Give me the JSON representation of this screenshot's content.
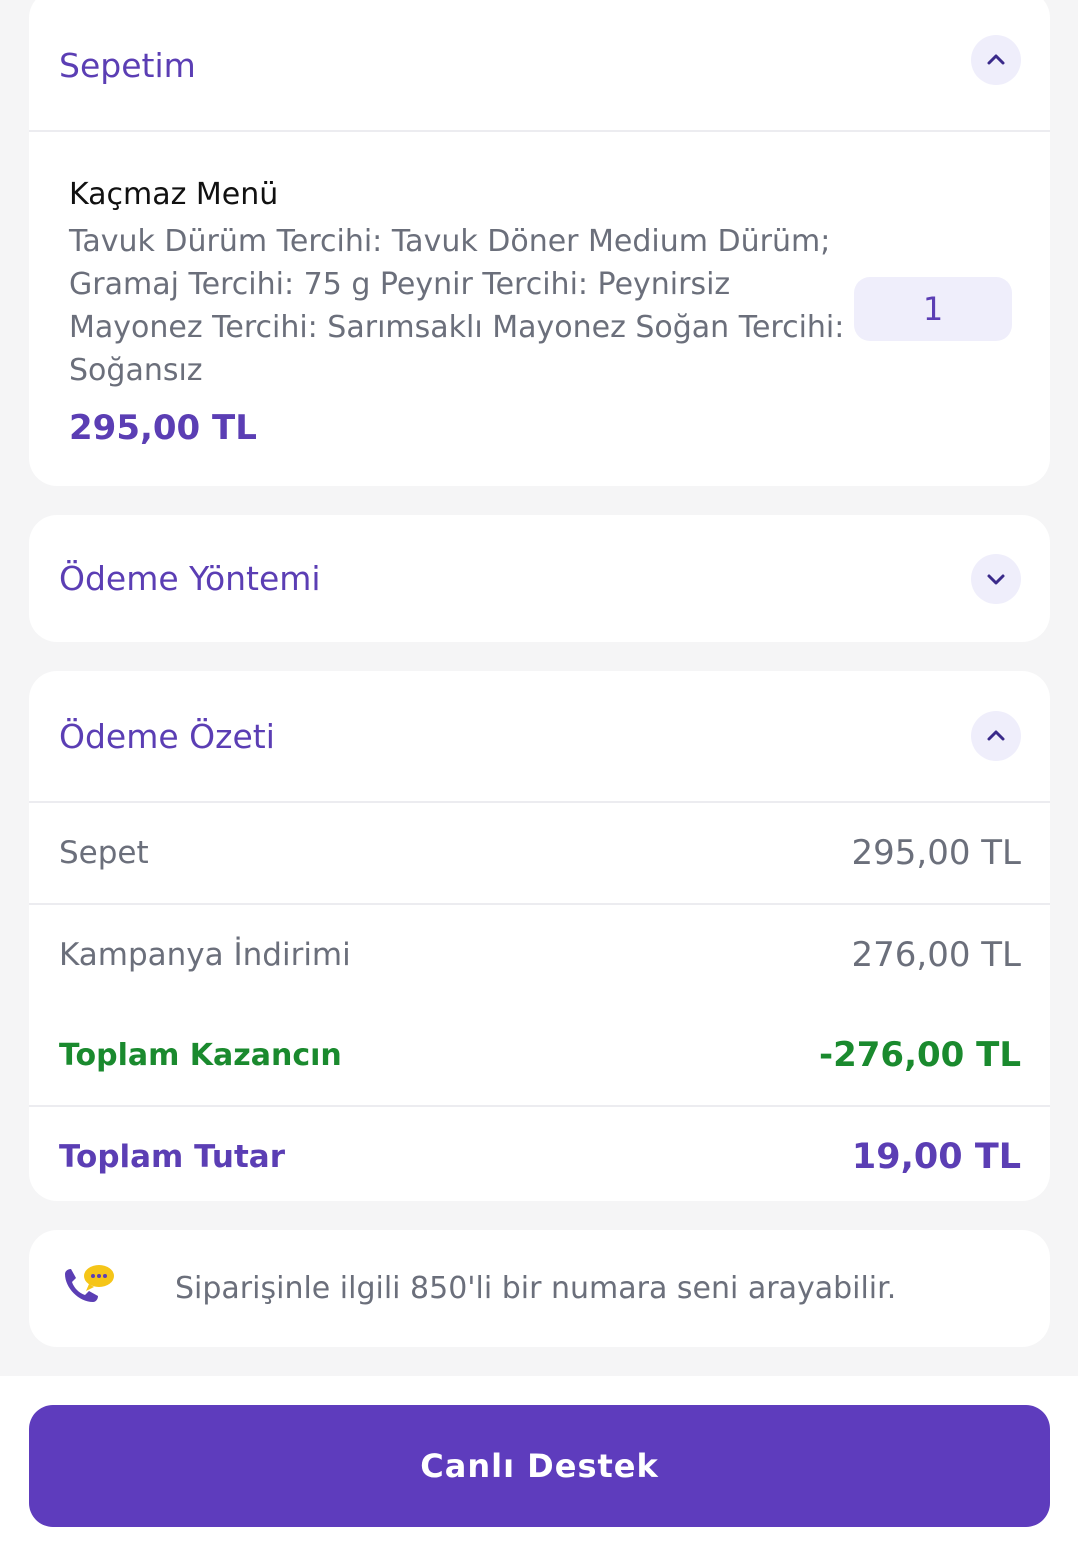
{
  "colors": {
    "accent": "#5b3eb4",
    "button": "#5e3cbd",
    "green": "#1a8a2e",
    "muted": "#6b6f7b",
    "chip_bg": "#efeefb",
    "page_bg": "#f5f5f6"
  },
  "basket": {
    "title": "Sepetim",
    "toggle_icon": "chevron-up-icon",
    "item": {
      "name": "Kaçmaz Menü",
      "description": "Tavuk Dürüm Tercihi: Tavuk Döner Medium Dürüm; Gramaj Tercihi: 75 g Peynir Tercihi: Peynirsiz Mayonez Tercihi: Sarımsaklı Mayonez Soğan Tercihi: Soğansız",
      "price": "295,00 TL",
      "quantity": "1"
    }
  },
  "payment_method": {
    "title": "Ödeme Yöntemi",
    "toggle_icon": "chevron-down-icon"
  },
  "summary": {
    "title": "Ödeme Özeti",
    "toggle_icon": "chevron-up-icon",
    "rows": [
      {
        "label": "Sepet",
        "value": "295,00 TL"
      },
      {
        "label": "Kampanya İndirimi",
        "value": "276,00 TL"
      },
      {
        "label": "Toplam Kazancın",
        "value": "-276,00 TL"
      },
      {
        "label": "Toplam Tutar",
        "value": "19,00 TL"
      }
    ]
  },
  "info": {
    "icon": "phone-chat-icon",
    "text": "Siparişinle ilgili 850'li bir numara seni arayabilir."
  },
  "support_button": {
    "label": "Canlı Destek"
  }
}
